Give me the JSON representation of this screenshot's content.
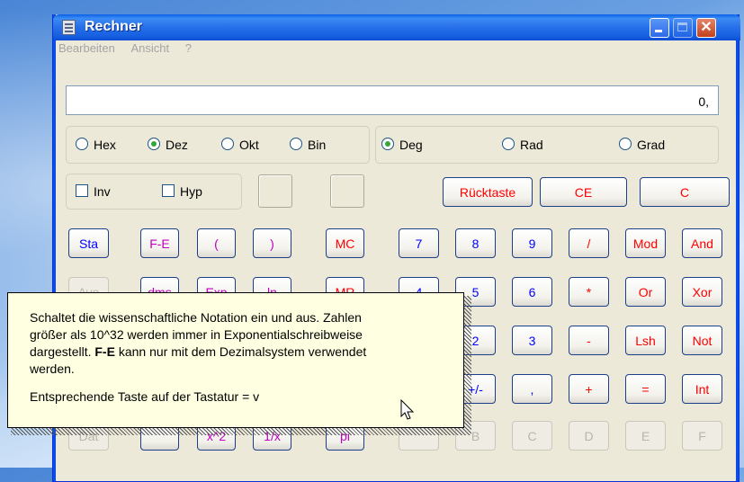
{
  "window": {
    "title": "Rechner"
  },
  "menu": [
    {
      "label": "Bearbeiten"
    },
    {
      "label": "Ansicht"
    },
    {
      "label": "?"
    }
  ],
  "display": {
    "value": "0,"
  },
  "number_system": [
    {
      "label": "Hex",
      "selected": false
    },
    {
      "label": "Dez",
      "selected": true
    },
    {
      "label": "Okt",
      "selected": false
    },
    {
      "label": "Bin",
      "selected": false
    }
  ],
  "angle_unit": [
    {
      "label": "Deg",
      "selected": true
    },
    {
      "label": "Rad",
      "selected": false
    },
    {
      "label": "Grad",
      "selected": false
    }
  ],
  "checkboxes": [
    {
      "label": "Inv",
      "checked": false
    },
    {
      "label": "Hyp",
      "checked": false
    }
  ],
  "top_buttons": {
    "backspace": "Rücktaste",
    "ce": "CE",
    "c": "C"
  },
  "keys": {
    "sta": "Sta",
    "fe": "F-E",
    "lparen": "(",
    "rparen": ")",
    "mc": "MC",
    "n7": "7",
    "n8": "8",
    "n9": "9",
    "div": "/",
    "mod": "Mod",
    "and": "And",
    "ave": "Ave",
    "dms": "dms",
    "exp": "Exp",
    "ln": "ln",
    "mr": "MR",
    "n4": "4",
    "n5": "5",
    "n6": "6",
    "mul": "*",
    "or": "Or",
    "xor": "Xor",
    "n2": "2",
    "n3": "3",
    "sub": "-",
    "lsh": "Lsh",
    "not": "Not",
    "sign": "+/-",
    "dot": ",",
    "add": "+",
    "eq": "=",
    "int": "Int",
    "b": "B",
    "c": "C",
    "d": "D",
    "e": "E",
    "f": "F",
    "dat": "Dat",
    "x2": "x^2",
    "recip": "1/x",
    "pi": "pi"
  },
  "tooltip": {
    "line1": "Schaltet die wissenschaftliche Notation ein und aus. Zahlen",
    "line2": "größer als 10^32 werden immer in Exponentialschreibweise",
    "line3_prefix": "dargestellt.",
    "line3_bold": "F-E",
    "line3_suffix": "kann nur mit dem Dezimalsystem verwendet",
    "line4": "werden.",
    "line5": "Entsprechende Taste auf der Tastatur = v"
  },
  "colors": {
    "blue_key": "#0000ff",
    "red_key": "#ff0000",
    "purple_key": "#c000c0",
    "tooltip_bg": "#ffffe1"
  },
  "icons": [
    "calculator-icon",
    "minimize-icon",
    "maximize-icon",
    "close-icon",
    "mouse-pointer-icon"
  ]
}
